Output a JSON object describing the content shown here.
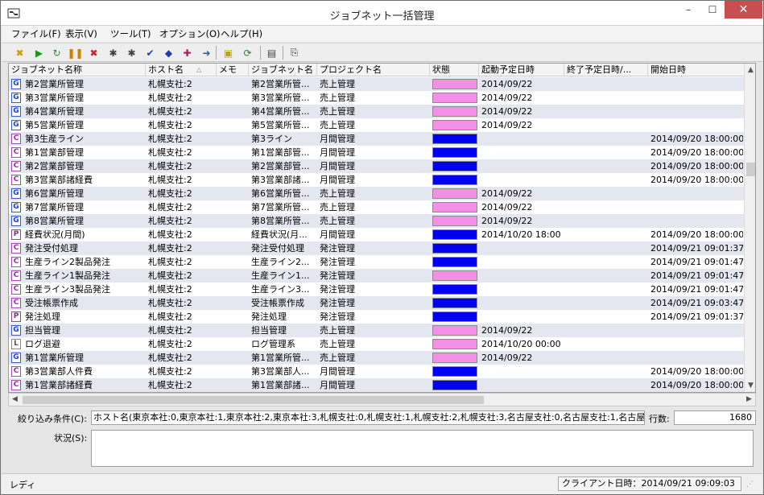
{
  "window": {
    "title": "ジョブネット一括管理",
    "controls": {
      "minimize": "–",
      "maximize": "☐",
      "close": "✕"
    }
  },
  "menu": [
    {
      "label": "ファイル(F)"
    },
    {
      "label": "表示(V)"
    },
    {
      "label": "ツール(T)"
    },
    {
      "label": "オプション(O)"
    },
    {
      "label": "ヘルプ(H)"
    }
  ],
  "toolbar": [
    {
      "icon": "cancel-icon",
      "glyph": "✖",
      "color": "#c8a000"
    },
    {
      "icon": "run-icon",
      "glyph": "▶",
      "color": "#1a9a1a"
    },
    {
      "icon": "rerun-icon",
      "glyph": "↻",
      "color": "#1a9a1a"
    },
    {
      "icon": "pause-icon",
      "glyph": "❚❚",
      "color": "#d08000"
    },
    {
      "icon": "stop-icon",
      "glyph": "✖",
      "color": "#d02020"
    },
    {
      "icon": "skip-icon",
      "glyph": "✱",
      "color": "#404040"
    },
    {
      "icon": "skip-cancel-icon",
      "glyph": "✱",
      "color": "#404040"
    },
    {
      "icon": "confirm-icon",
      "glyph": "✔",
      "color": "#2040b0"
    },
    {
      "icon": "hold-icon",
      "glyph": "◆",
      "color": "#2040b0"
    },
    {
      "icon": "release-icon",
      "glyph": "✚",
      "color": "#b02060"
    },
    {
      "icon": "forward-icon",
      "glyph": "➜",
      "color": "#2060a0"
    },
    {
      "icon": "lock-icon",
      "glyph": "▣",
      "color": "#c0a000"
    },
    {
      "icon": "refresh-icon",
      "glyph": "⟳",
      "color": "#208020"
    },
    {
      "icon": "properties-icon",
      "glyph": "▤",
      "color": "#404040"
    },
    {
      "icon": "export-icon",
      "glyph": "⎘",
      "color": "#404040"
    }
  ],
  "grid": {
    "columns": [
      "ジョブネット名称",
      "ホスト名",
      "メモ",
      "ジョブネット名",
      "プロジェクト名",
      "状態",
      "起動予定日時",
      "終了予定日時/...",
      "開始日時"
    ],
    "rows": [
      {
        "type": "G",
        "name": "第2営業所管理",
        "host": "札幌支社:2",
        "memo": "",
        "jobnet": "第2営業所管...",
        "project": "売上管理",
        "status": "#f48fe6",
        "scheduled": "2014/09/22",
        "end": "",
        "start": ""
      },
      {
        "type": "G",
        "name": "第3営業所管理",
        "host": "札幌支社:2",
        "memo": "",
        "jobnet": "第3営業所管...",
        "project": "売上管理",
        "status": "#f48fe6",
        "scheduled": "2014/09/22",
        "end": "",
        "start": ""
      },
      {
        "type": "G",
        "name": "第4営業所管理",
        "host": "札幌支社:2",
        "memo": "",
        "jobnet": "第4営業所管...",
        "project": "売上管理",
        "status": "#f48fe6",
        "scheduled": "2014/09/22",
        "end": "",
        "start": ""
      },
      {
        "type": "G",
        "name": "第5営業所管理",
        "host": "札幌支社:2",
        "memo": "",
        "jobnet": "第5営業所管...",
        "project": "売上管理",
        "status": "#f48fe6",
        "scheduled": "2014/09/22",
        "end": "",
        "start": ""
      },
      {
        "type": "C",
        "name": "第3生産ライン",
        "host": "札幌支社:2",
        "memo": "",
        "jobnet": "第3ライン",
        "project": "月間管理",
        "status": "#0000ee",
        "scheduled": "",
        "end": "",
        "start": "2014/09/20 18:00:00"
      },
      {
        "type": "C",
        "name": "第1営業部管理",
        "host": "札幌支社:2",
        "memo": "",
        "jobnet": "第1営業部管...",
        "project": "月間管理",
        "status": "#0000ee",
        "scheduled": "",
        "end": "",
        "start": "2014/09/20 18:00:00"
      },
      {
        "type": "C",
        "name": "第2営業部管理",
        "host": "札幌支社:2",
        "memo": "",
        "jobnet": "第2営業部管...",
        "project": "月間管理",
        "status": "#0000ee",
        "scheduled": "",
        "end": "",
        "start": "2014/09/20 18:00:00"
      },
      {
        "type": "C",
        "name": "第3営業部諸経費",
        "host": "札幌支社:2",
        "memo": "",
        "jobnet": "第3営業部諸...",
        "project": "月間管理",
        "status": "#0000ee",
        "scheduled": "",
        "end": "",
        "start": "2014/09/20 18:00:00"
      },
      {
        "type": "G",
        "name": "第6営業所管理",
        "host": "札幌支社:2",
        "memo": "",
        "jobnet": "第6営業所管...",
        "project": "売上管理",
        "status": "#f48fe6",
        "scheduled": "2014/09/22",
        "end": "",
        "start": ""
      },
      {
        "type": "G",
        "name": "第7営業所管理",
        "host": "札幌支社:2",
        "memo": "",
        "jobnet": "第7営業所管...",
        "project": "売上管理",
        "status": "#f48fe6",
        "scheduled": "2014/09/22",
        "end": "",
        "start": ""
      },
      {
        "type": "G",
        "name": "第8営業所管理",
        "host": "札幌支社:2",
        "memo": "",
        "jobnet": "第8営業所管...",
        "project": "売上管理",
        "status": "#f48fe6",
        "scheduled": "2014/09/22",
        "end": "",
        "start": ""
      },
      {
        "type": "P",
        "name": "経費状況(月間)",
        "host": "札幌支社:2",
        "memo": "",
        "jobnet": "経費状況(月...",
        "project": "月間管理",
        "status": "#0000ee",
        "scheduled": "2014/10/20 18:00",
        "end": "",
        "start": "2014/09/20 18:00:00"
      },
      {
        "type": "C",
        "name": "発注受付処理",
        "host": "札幌支社:2",
        "memo": "",
        "jobnet": "発注受付処理",
        "project": "発注管理",
        "status": "#0000ee",
        "scheduled": "",
        "end": "",
        "start": "2014/09/21 09:01:37"
      },
      {
        "type": "C",
        "name": "生産ライン2製品発注",
        "host": "札幌支社:2",
        "memo": "",
        "jobnet": "生産ライン2...",
        "project": "発注管理",
        "status": "#0000ee",
        "scheduled": "",
        "end": "",
        "start": "2014/09/21 09:01:47"
      },
      {
        "type": "C",
        "name": "生産ライン1製品発注",
        "host": "札幌支社:2",
        "memo": "",
        "jobnet": "生産ライン1...",
        "project": "発注管理",
        "status": "#f48fe6",
        "scheduled": "",
        "end": "",
        "start": "2014/09/21 09:01:47"
      },
      {
        "type": "C",
        "name": "生産ライン3製品発注",
        "host": "札幌支社:2",
        "memo": "",
        "jobnet": "生産ライン3...",
        "project": "発注管理",
        "status": "#0000ee",
        "scheduled": "",
        "end": "",
        "start": "2014/09/21 09:01:47"
      },
      {
        "type": "C",
        "name": "受注帳票作成",
        "host": "札幌支社:2",
        "memo": "",
        "jobnet": "受注帳票作成",
        "project": "発注管理",
        "status": "#0000ee",
        "scheduled": "",
        "end": "",
        "start": "2014/09/21 09:03:47"
      },
      {
        "type": "P",
        "name": "発注処理",
        "host": "札幌支社:2",
        "memo": "",
        "jobnet": "発注処理",
        "project": "発注管理",
        "status": "#0000ee",
        "scheduled": "",
        "end": "",
        "start": "2014/09/21 09:01:37"
      },
      {
        "type": "G",
        "name": "担当管理",
        "host": "札幌支社:2",
        "memo": "",
        "jobnet": "担当管理",
        "project": "売上管理",
        "status": "#f48fe6",
        "scheduled": "2014/09/22",
        "end": "",
        "start": ""
      },
      {
        "type": "L",
        "name": "ログ退避",
        "host": "札幌支社:2",
        "memo": "",
        "jobnet": "ログ管理系",
        "project": "売上管理",
        "status": "#f48fe6",
        "scheduled": "2014/10/20 00:00",
        "end": "",
        "start": ""
      },
      {
        "type": "G",
        "name": "第1営業所管理",
        "host": "札幌支社:2",
        "memo": "",
        "jobnet": "第1営業所管...",
        "project": "売上管理",
        "status": "#f48fe6",
        "scheduled": "2014/09/22",
        "end": "",
        "start": ""
      },
      {
        "type": "C",
        "name": "第3営業部人件費",
        "host": "札幌支社:2",
        "memo": "",
        "jobnet": "第3営業部人...",
        "project": "月間管理",
        "status": "#0000ee",
        "scheduled": "",
        "end": "",
        "start": "2014/09/20 18:00:00"
      },
      {
        "type": "C",
        "name": "第1営業部諸経費",
        "host": "札幌支社:2",
        "memo": "",
        "jobnet": "第1営業部諸...",
        "project": "月間管理",
        "status": "#0000ee",
        "scheduled": "",
        "end": "",
        "start": "2014/09/20 18:00:00"
      }
    ]
  },
  "filter": {
    "label": "絞り込み条件(C):",
    "value": "ホスト名(東京本社:0,東京本社:1,東京本社:2,東京本社:3,札幌支社:0,札幌支社:1,札幌支社:2,札幌支社:3,名古屋支社:0,名古屋支社:1,名古屋",
    "count_label": "行数:",
    "count": "1680"
  },
  "status_section": {
    "label": "状況(S):",
    "value": ""
  },
  "statusbar": {
    "ready": "レディ",
    "client_time": "クライアント日時：2014/09/21 09:09:03"
  }
}
